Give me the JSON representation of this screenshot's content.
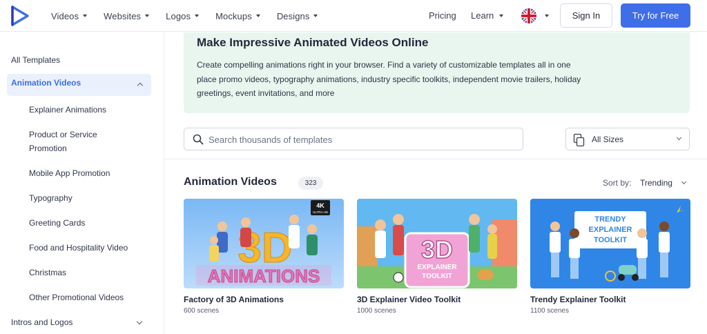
{
  "header": {
    "nav": [
      {
        "label": "Videos"
      },
      {
        "label": "Websites"
      },
      {
        "label": "Logos"
      },
      {
        "label": "Mockups"
      },
      {
        "label": "Designs"
      }
    ],
    "pricing": "Pricing",
    "learn": "Learn",
    "sign_in": "Sign In",
    "try_free": "Try for Free",
    "accent_color": "#3f6ee8"
  },
  "sidebar": {
    "all_templates": "All Templates",
    "active_category": "Animation Videos",
    "subitems": [
      "Explainer Animations",
      "Product or Service Promotion",
      "Mobile App Promotion",
      "Typography",
      "Greeting Cards",
      "Food and Hospitality Video",
      "Christmas",
      "Other Promotional Videos"
    ],
    "intros_logos": "Intros and Logos"
  },
  "banner": {
    "title": "Make Impressive Animated Videos Online",
    "text": "Create compelling animations right in your browser. Find a variety of customizable templates all in one place promo videos, typography animations, industry specific toolkits, independent movie trailers, holiday greetings, event invitations, and more"
  },
  "search": {
    "placeholder": "Search thousands of templates",
    "sizes_label": "All Sizes"
  },
  "section": {
    "title": "Animation Videos",
    "count": "323",
    "sort_label": "Sort by:",
    "sort_value": "Trending"
  },
  "cards": [
    {
      "title": "Factory of 3D Animations",
      "scenes": "600 scenes",
      "badge_main": "4K",
      "badge_sub": "ULTRA HD",
      "thumb_text": "ANIMATIONS"
    },
    {
      "title": "3D Explainer Video Toolkit",
      "scenes": "1000 scenes",
      "thumb_big": "3D",
      "thumb_line1": "EXPLAINER",
      "thumb_line2": "TOOLKIT"
    },
    {
      "title": "Trendy Explainer Toolkit",
      "scenes": "1100 scenes",
      "thumb_line1": "TRENDY",
      "thumb_line2": "EXPLAINER",
      "thumb_line3": "TOOLKIT"
    }
  ]
}
